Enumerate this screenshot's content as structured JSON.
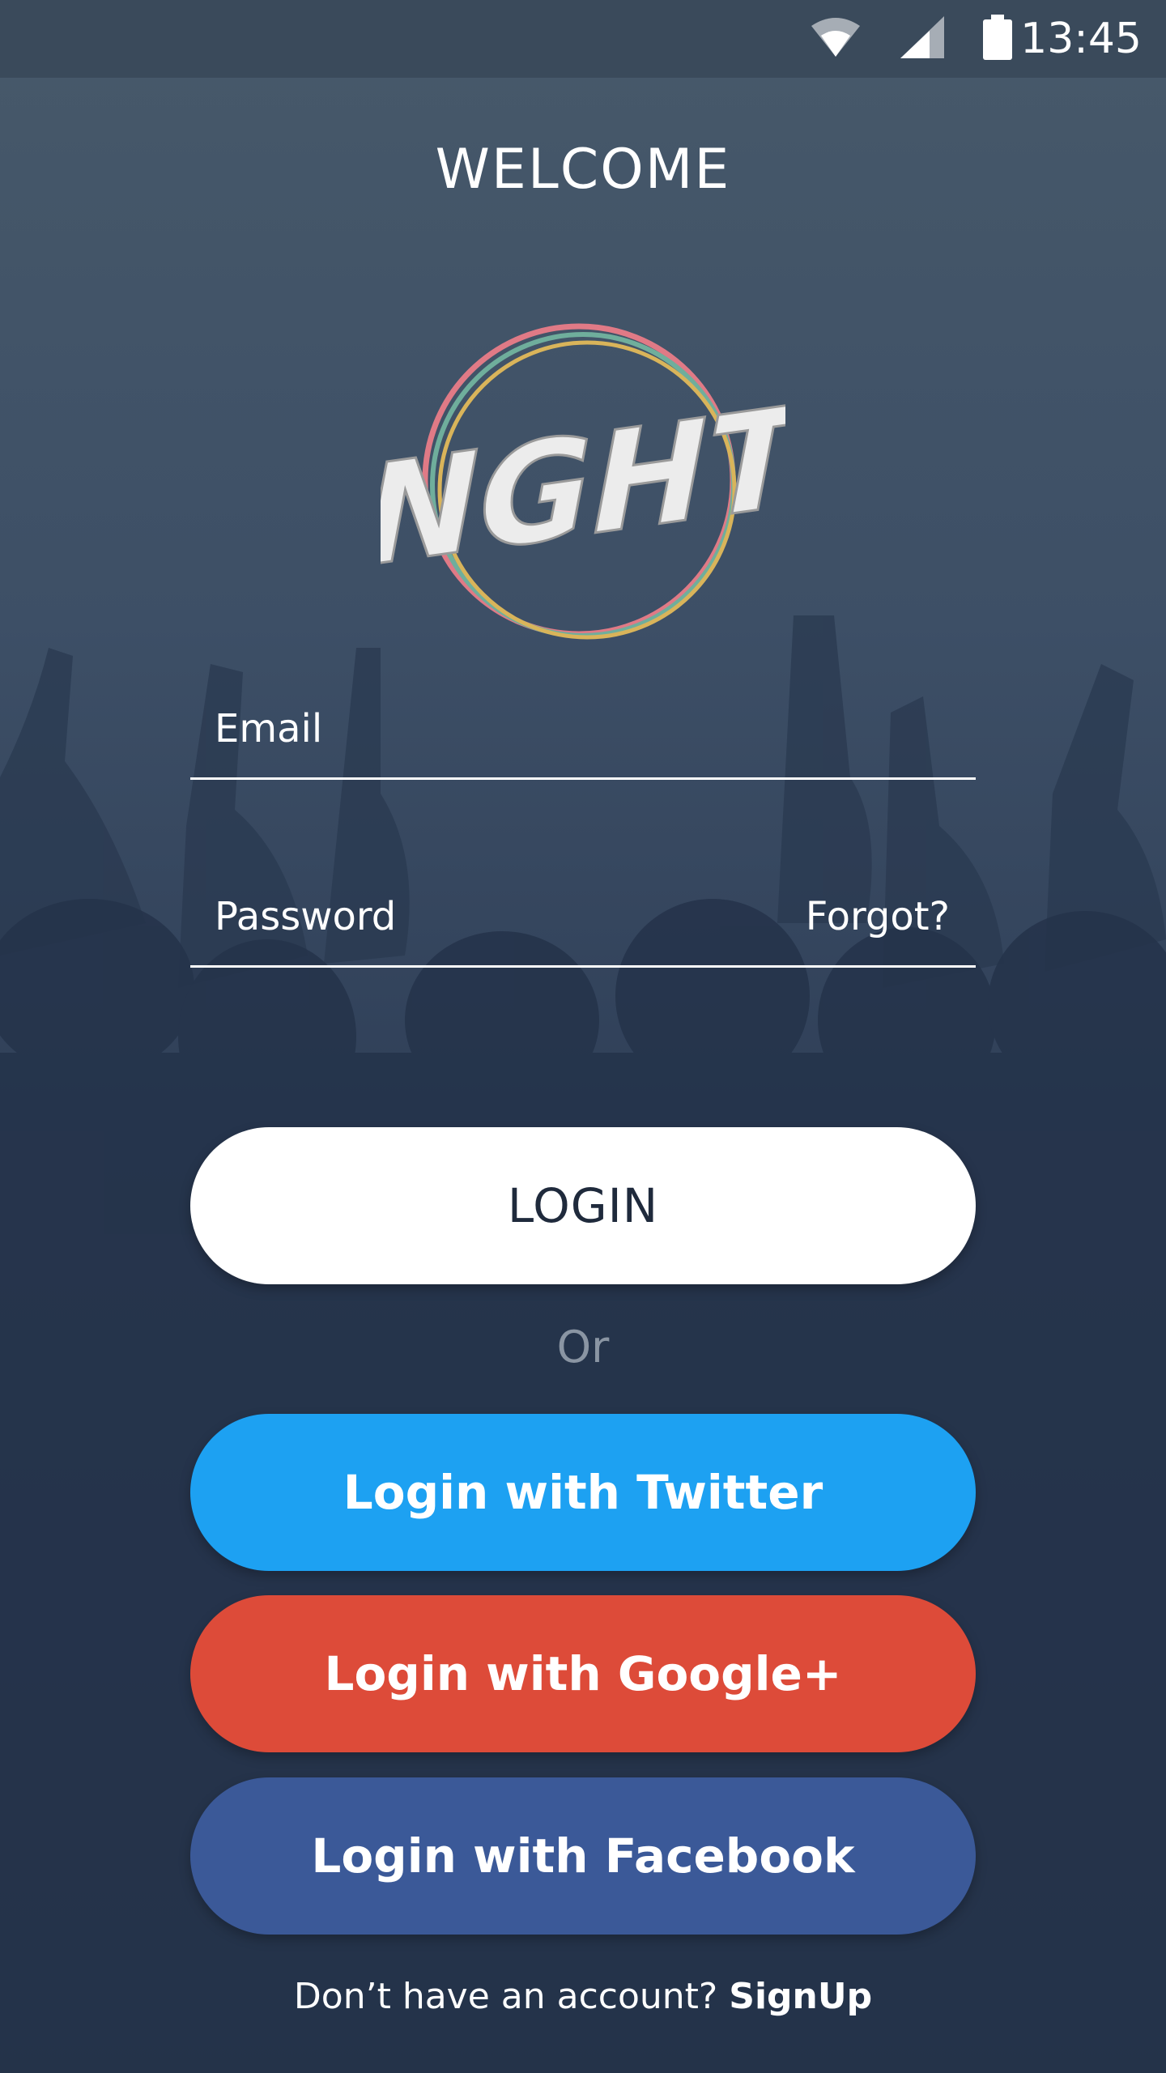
{
  "status_bar": {
    "time": "13:45",
    "icons": [
      "wifi-icon",
      "signal-icon",
      "battery-icon"
    ]
  },
  "header": {
    "title": "WELCOME"
  },
  "logo": {
    "text": "NGHT"
  },
  "form": {
    "email_label": "Email",
    "password_label": "Password",
    "forgot_label": "Forgot?"
  },
  "buttons": {
    "login": "LOGIN",
    "or": "Or",
    "twitter": "Login with Twitter",
    "google": "Login with Google+",
    "facebook": "Login with Facebook"
  },
  "footer": {
    "prompt": "Don’t have an account?",
    "signup": "SignUp"
  },
  "colors": {
    "twitter": "#1da1f2",
    "google": "#dd4b39",
    "facebook": "#3b5998",
    "background": "#2f3f58"
  }
}
